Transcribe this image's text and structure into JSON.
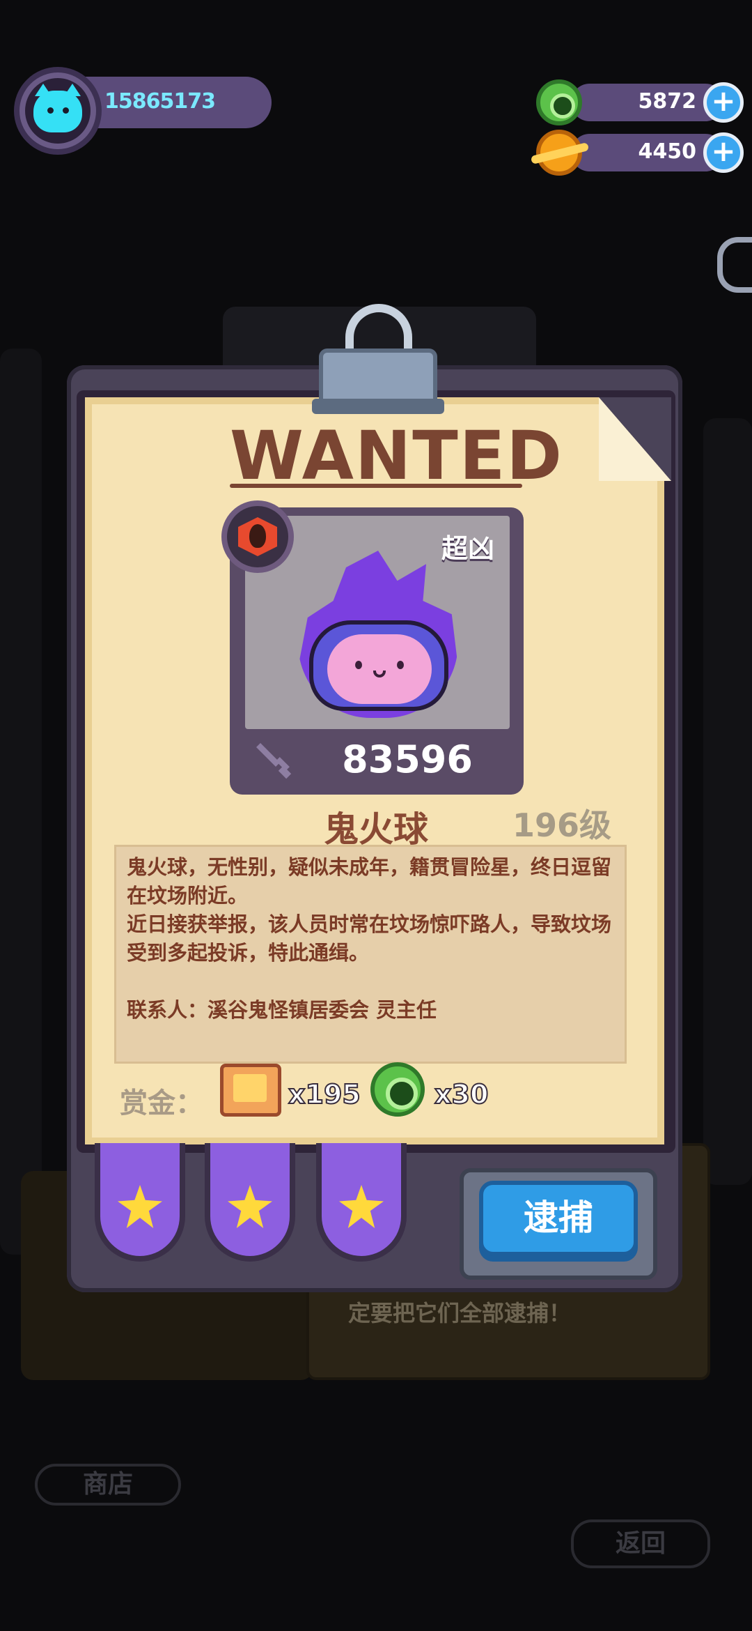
{
  "player": {
    "id": "15865173"
  },
  "currency": [
    {
      "name": "green-gem",
      "value": "5872"
    },
    {
      "name": "planet-coin",
      "value": "4450"
    }
  ],
  "wanted": {
    "title": "WANTED",
    "danger": "超凶",
    "power": "83596",
    "name": "鬼火球",
    "level": "196级",
    "description": [
      "鬼火球，无性别，疑似未成年，籍贯冒险星，终日逗留在坟场附近。",
      "近日接获举报，该人员时常在坟场惊吓路人，导致坟场受到多起投诉，特此通缉。",
      "",
      "联系人：溪谷鬼怪镇居委会 灵主任"
    ],
    "reward_label": "赏金：",
    "rewards": [
      {
        "icon": "food-chip-icon",
        "qty": "x195"
      },
      {
        "icon": "green-gem-icon",
        "qty": "x30"
      }
    ],
    "stars": 3,
    "arrest_label": "逮捕"
  },
  "background": {
    "note_text": "定要把它们全部逮捕！",
    "shop_label": "商店",
    "back_label": "返回"
  },
  "colors": {
    "paper": "#f6e3b4",
    "title": "#7a4532",
    "accent_blue": "#2f9ce6",
    "star": "#ffd93b",
    "tab_purple": "#8d5fe0"
  }
}
